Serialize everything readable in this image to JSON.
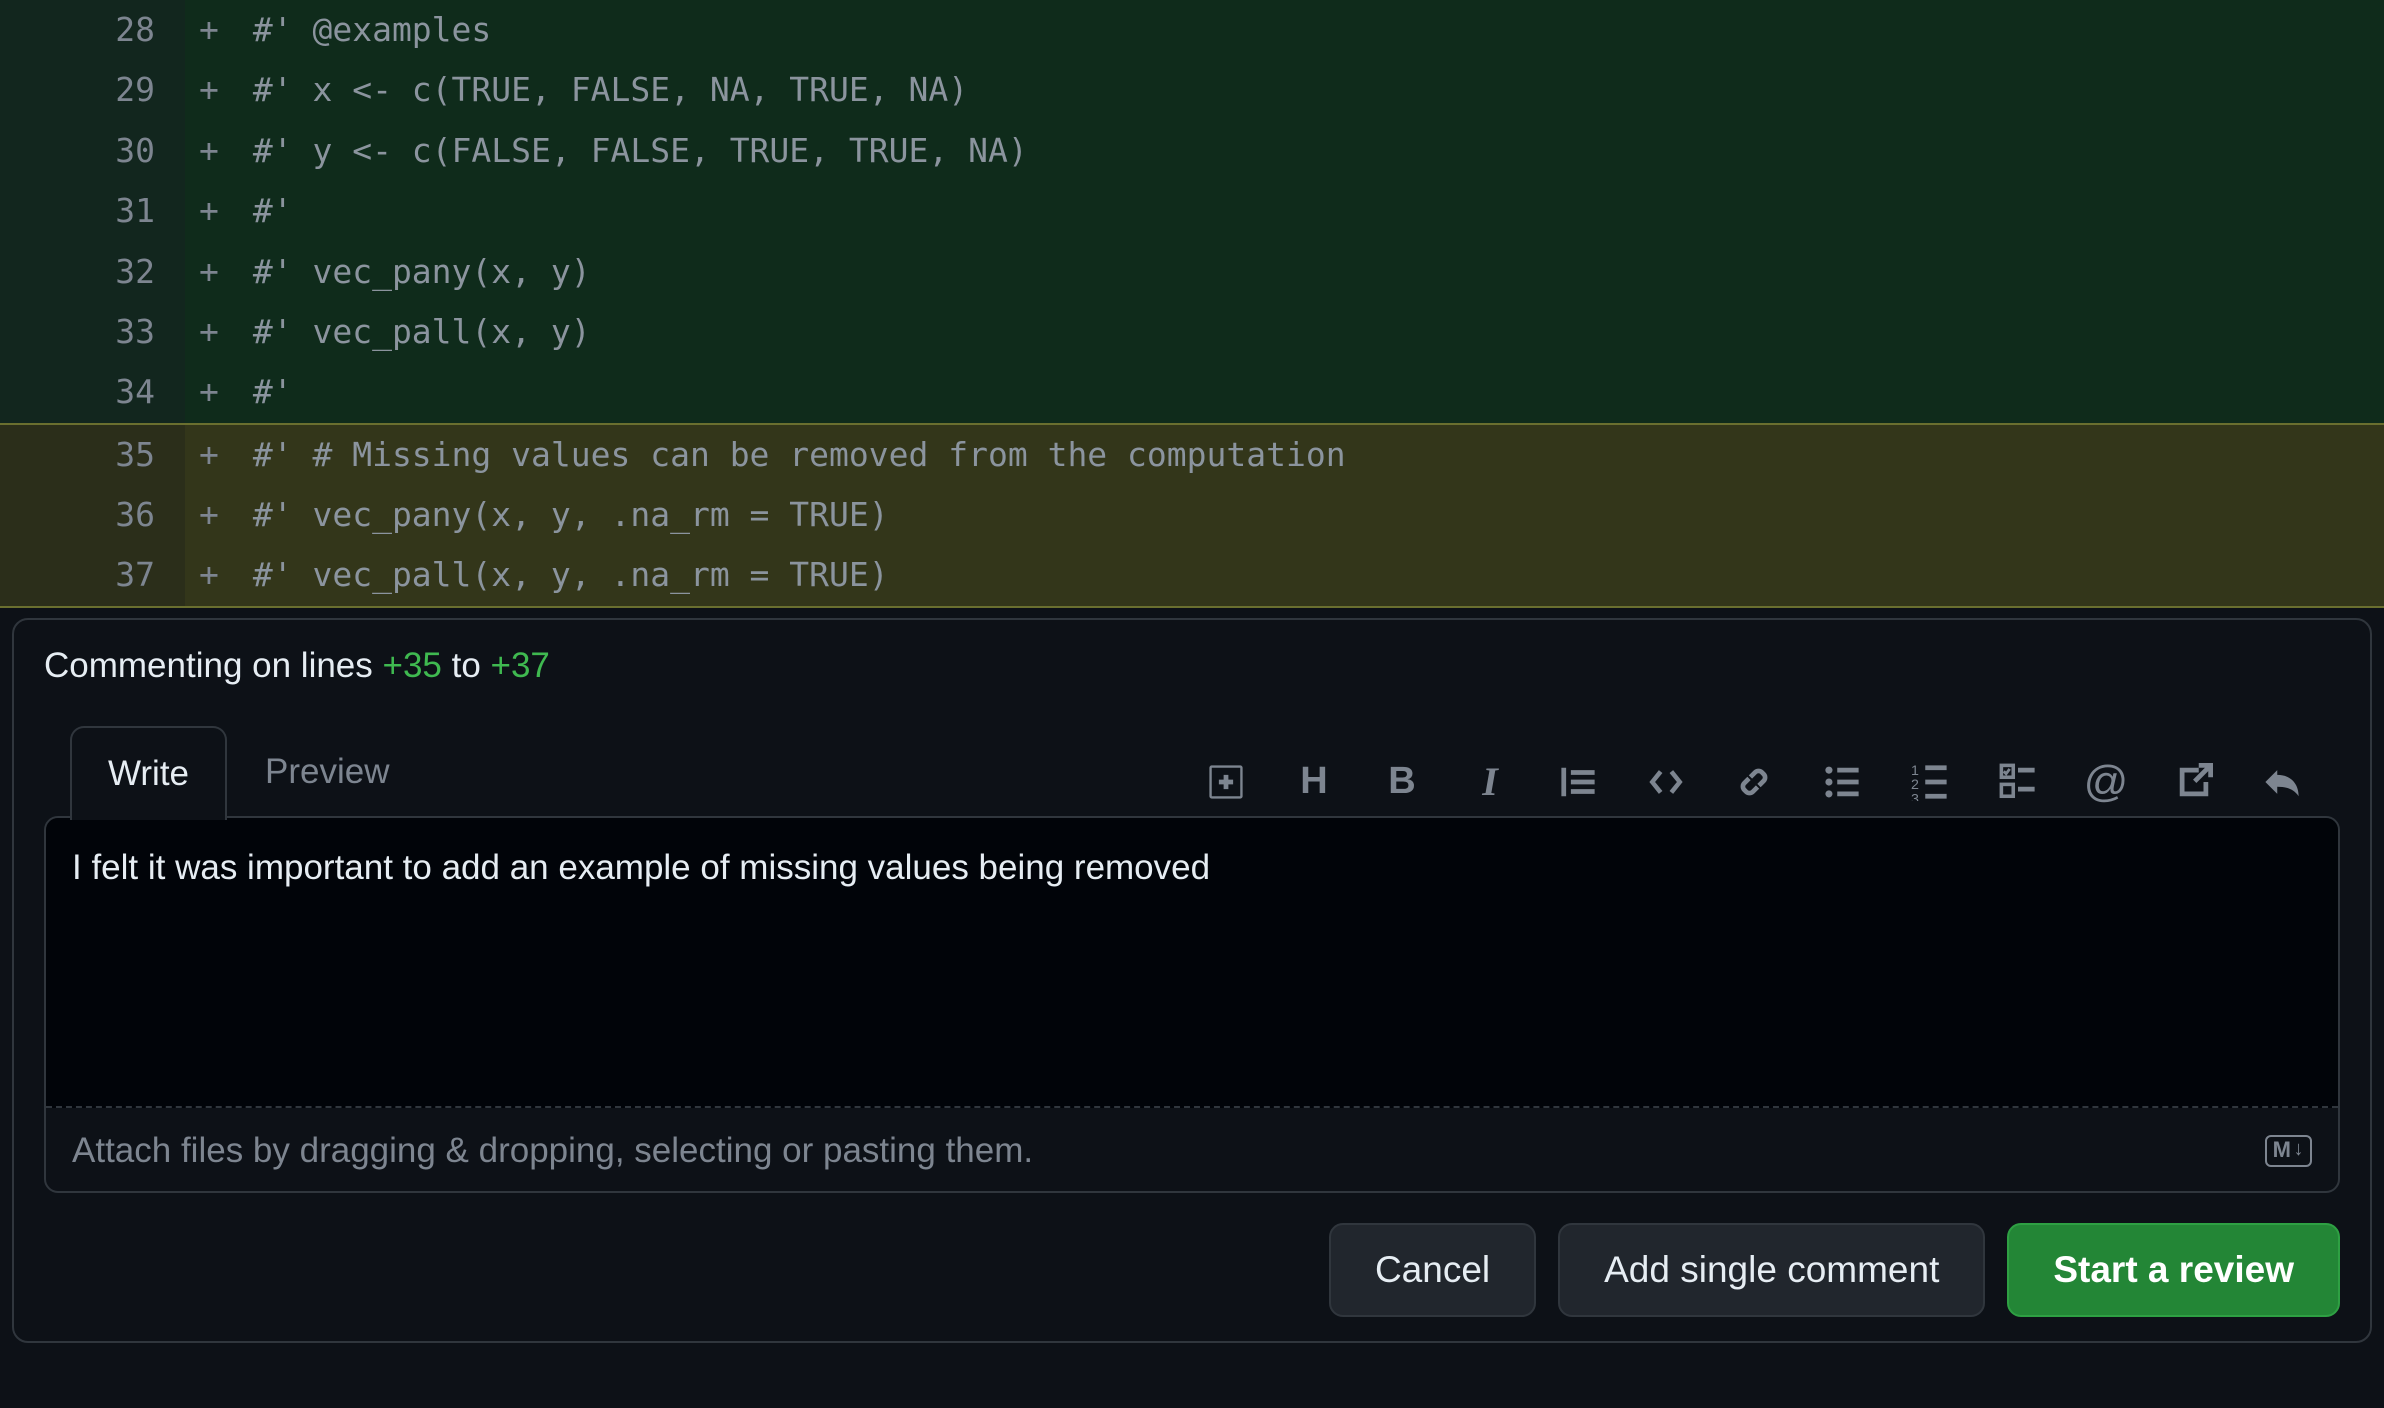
{
  "diff": {
    "lines": [
      {
        "num": "28",
        "marker": "+",
        "code": "#' @examples",
        "highlight": false
      },
      {
        "num": "29",
        "marker": "+",
        "code": "#' x <- c(TRUE, FALSE, NA, TRUE, NA)",
        "highlight": false
      },
      {
        "num": "30",
        "marker": "+",
        "code": "#' y <- c(FALSE, FALSE, TRUE, TRUE, NA)",
        "highlight": false
      },
      {
        "num": "31",
        "marker": "+",
        "code": "#'",
        "highlight": false
      },
      {
        "num": "32",
        "marker": "+",
        "code": "#' vec_pany(x, y)",
        "highlight": false
      },
      {
        "num": "33",
        "marker": "+",
        "code": "#' vec_pall(x, y)",
        "highlight": false
      },
      {
        "num": "34",
        "marker": "+",
        "code": "#'",
        "highlight": false
      },
      {
        "num": "35",
        "marker": "+",
        "code": "#' # Missing values can be removed from the computation",
        "highlight": true
      },
      {
        "num": "36",
        "marker": "+",
        "code": "#' vec_pany(x, y, .na_rm = TRUE)",
        "highlight": true
      },
      {
        "num": "37",
        "marker": "+",
        "code": "#' vec_pall(x, y, .na_rm = TRUE)",
        "highlight": true
      }
    ]
  },
  "comment_meta": {
    "prefix": "Commenting on lines ",
    "from": "+35",
    "to_word": " to ",
    "to": "+37"
  },
  "tabs": {
    "write": "Write",
    "preview": "Preview"
  },
  "toolbar_icons": {
    "suggestion": "suggestion-icon",
    "heading": "H",
    "bold": "B",
    "italic": "I",
    "quote": "quote",
    "code": "code",
    "link": "link",
    "ul": "ul",
    "ol": "ol",
    "task": "task",
    "mention": "@",
    "crossref": "crossref",
    "reply": "reply"
  },
  "editor": {
    "value": "I felt it was important to add an example of missing values being removed",
    "attach_hint": "Attach files by dragging & dropping, selecting or pasting them.",
    "md_badge": "M"
  },
  "buttons": {
    "cancel": "Cancel",
    "single": "Add single comment",
    "start": "Start a review"
  }
}
